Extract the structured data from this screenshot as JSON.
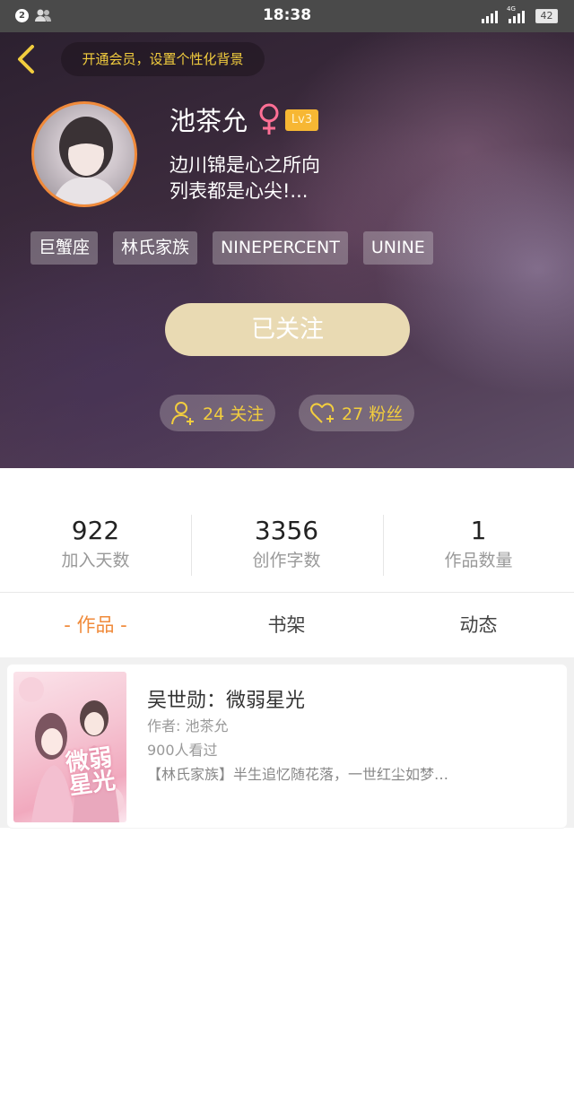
{
  "status_bar": {
    "notification_count": "2",
    "time": "18:38",
    "network": "4G",
    "battery": "42"
  },
  "header": {
    "vip_prompt": "开通会员，设置个性化背景"
  },
  "profile": {
    "name": "池茶允",
    "level": "Lv3",
    "bio_line1": "边川锦是心之所向",
    "bio_line2": "列表都是心尖!...",
    "tags": [
      "巨蟹座",
      "林氏家族",
      "NINEPERCENT",
      "UNINE"
    ],
    "follow_state_label": "已关注",
    "following_label": "24 关注",
    "fans_label": "27 粉丝"
  },
  "stats": [
    {
      "value": "922",
      "label": "加入天数"
    },
    {
      "value": "3356",
      "label": "创作字数"
    },
    {
      "value": "1",
      "label": "作品数量"
    }
  ],
  "tabs": [
    {
      "label": "- 作品 -",
      "active": true
    },
    {
      "label": "书架",
      "active": false
    },
    {
      "label": "动态",
      "active": false
    }
  ],
  "works": [
    {
      "title": "吴世勋：微弱星光",
      "author": "作者: 池茶允",
      "views": "900人看过",
      "description": "【林氏家族】半生追忆随花落，一世红尘如梦…",
      "cover_text": "微弱星光"
    }
  ],
  "colors": {
    "accent": "#f08a3a",
    "gold": "#f2cd3e",
    "follow_button": "#e9dab3",
    "level_badge": "#f7b733"
  }
}
